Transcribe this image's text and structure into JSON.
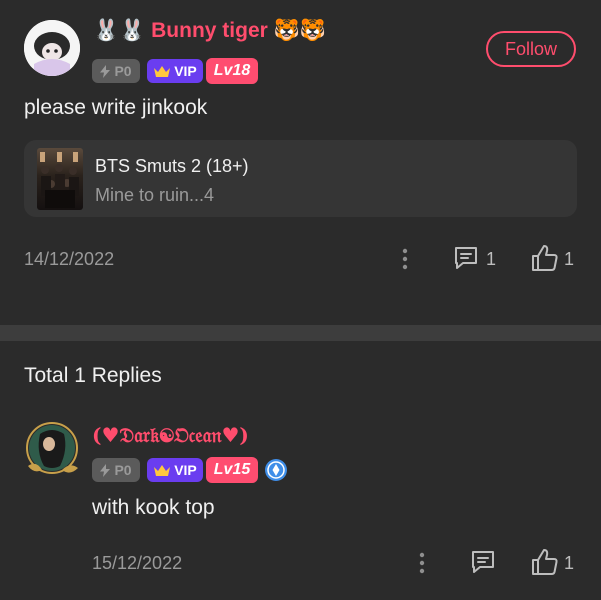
{
  "post": {
    "username": "🐰🐰 Bunny tiger 🐯🐯",
    "badges": {
      "p": "P0",
      "vip": "VIP",
      "level": "Lv18"
    },
    "follow_label": "Follow",
    "text": "please write jinkook",
    "card": {
      "title": "BTS Smuts 2 (18+)",
      "subtitle": "Mine to ruin...4"
    },
    "date": "14/12/2022",
    "comment_count": "1",
    "like_count": "1"
  },
  "replies": {
    "total_label": "Total 1 Replies",
    "items": [
      {
        "username": "(♥𝔇𝔞𝔯𝔨☯𝔒𝔠𝔢𝔞𝔫♥)",
        "badges": {
          "p": "P0",
          "vip": "VIP",
          "level": "Lv15"
        },
        "text": "with kook top",
        "date": "15/12/2022",
        "like_count": "1"
      }
    ]
  },
  "colors": {
    "accent": "#ff4d6d",
    "vip": "#6a3df0",
    "level": "#ff4d70",
    "background": "#2b2b2b"
  },
  "icons": [
    "avatar",
    "bolt-icon",
    "crown-icon",
    "more-icon",
    "comment-icon",
    "thumbs-up-icon",
    "verified-badge-icon"
  ]
}
